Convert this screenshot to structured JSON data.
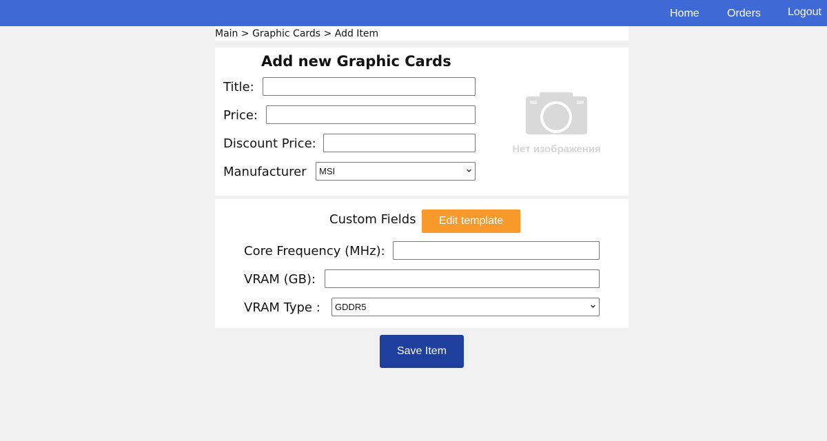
{
  "nav": {
    "home": "Home",
    "orders": "Orders",
    "logout": "Logout"
  },
  "breadcrumb": {
    "main": "Main",
    "category": "Graphic Cards",
    "current": "Add Item",
    "separator": " > "
  },
  "form": {
    "heading": "Add new Graphic Cards",
    "title_label": "Title:",
    "title_value": "",
    "price_label": "Price:",
    "price_value": "",
    "discount_label": "Discount Price:",
    "discount_value": "",
    "manufacturer_label": "Manufacturer",
    "manufacturer_value": "MSI"
  },
  "image_placeholder": {
    "icon": "camera-icon",
    "text": "Нет изображения"
  },
  "custom_fields": {
    "heading": "Custom Fields",
    "edit_button": "Edit template",
    "core_label": "Core Frequency (MHz):",
    "core_value": "",
    "vram_label": "VRAM (GB):",
    "vram_value": "",
    "vram_type_label": "VRAM Type :",
    "vram_type_value": "GDDR5"
  },
  "save_button": "Save Item",
  "colors": {
    "topbar": "#3f69d4",
    "edit_button": "#f7992b",
    "save_button": "#1e3f9b",
    "background": "#f0f0f0"
  }
}
